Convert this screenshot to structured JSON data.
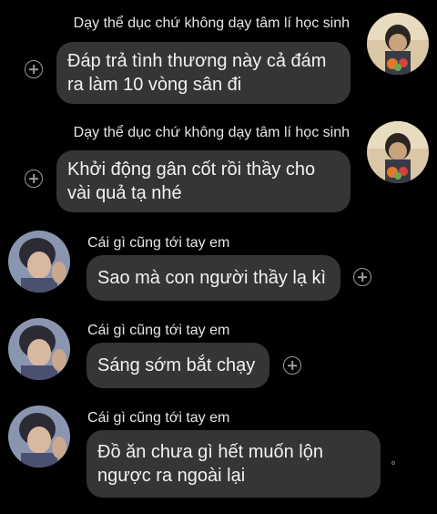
{
  "messages": [
    {
      "sender": "Dạy thể dục chứ không dạy tâm lí học sinh",
      "text": "Đáp trả tình thương này cả đám ra làm 10 vòng sân đi",
      "side": "right",
      "avatar_icon": "teacher-avatar"
    },
    {
      "sender": "Dạy thể dục chứ không dạy tâm lí học sinh",
      "text": "Khởi động gân cốt rồi thầy cho vài quả tạ nhé",
      "side": "right",
      "avatar_icon": "teacher-avatar"
    },
    {
      "sender": "Cái gì cũng tới tay em",
      "text": "Sao mà con người thầy lạ kì",
      "side": "left",
      "avatar_icon": "student-avatar"
    },
    {
      "sender": "Cái gì cũng tới tay em",
      "text": "Sáng sớm bắt chạy",
      "side": "left",
      "avatar_icon": "student-avatar"
    },
    {
      "sender": "Cái gì cũng tới tay em",
      "text": "Đồ ăn chưa gì hết muốn lộn ngược ra ngoài lại",
      "side": "left",
      "avatar_icon": "student-avatar"
    }
  ],
  "icons": {
    "react": "add-reaction-icon"
  },
  "colors": {
    "background": "#000000",
    "bubble": "#353535",
    "text": "#f2f2f2"
  }
}
